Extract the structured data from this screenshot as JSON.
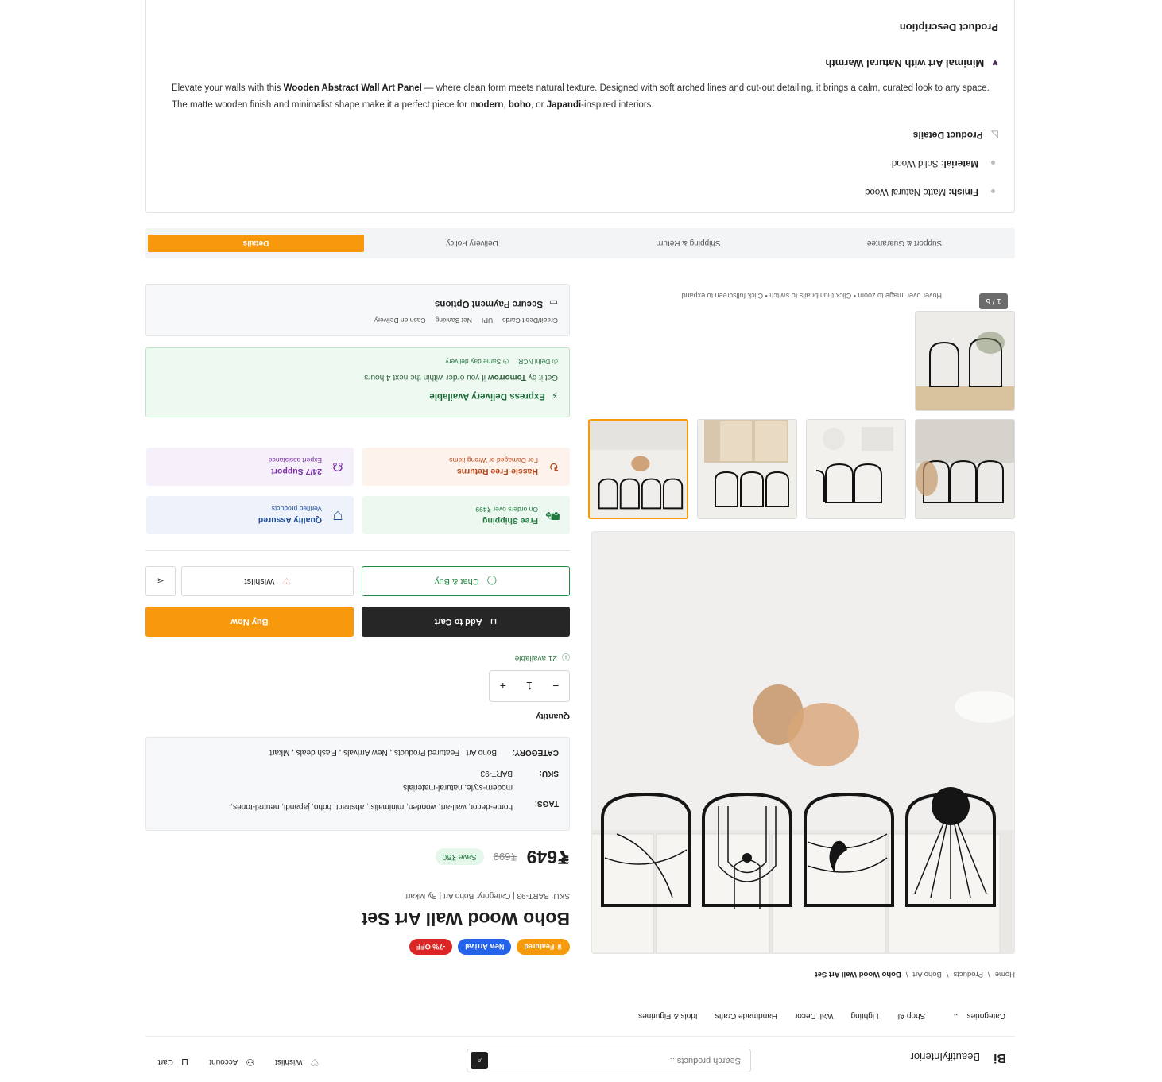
{
  "header": {
    "logo_mark": "Bi",
    "logo_text": "BeautifyInterior",
    "search_placeholder": "Search products...",
    "wishlist": "Wishlist",
    "account": "Account",
    "cart": "Cart"
  },
  "nav": {
    "categories": "Categories",
    "items": [
      "Shop All",
      "Lighting",
      "Wall Decor",
      "Handmade Crafts",
      "Idols & Figurines"
    ]
  },
  "breadcrumb": [
    "Home",
    "Products",
    "Boho Art",
    "Boho Wood Wall Art Set"
  ],
  "gallery": {
    "counter": "1 / 5",
    "hint": "Hover over image to zoom • Click thumbnails to switch • Click fullscreen to expand"
  },
  "product": {
    "badges": [
      "♛ Featured",
      "New Arrival",
      "-7% OFF"
    ],
    "badge_colors": [
      "#f59a0b",
      "#2563eb",
      "#dc2626"
    ],
    "title": "Boho Wood Wall Art Set",
    "meta": "SKU: BART-93 | Category: Boho Art | By Mkart",
    "price": "₹649",
    "mrp": "₹699",
    "save": "Save ₹50"
  },
  "info": {
    "category_label": "CATEGORY:",
    "category_value": "Boho Art , Featured Products , New Arrivals , Flash deals , Mkart",
    "sku_label": "SKU:",
    "sku_value": "BART-93",
    "tags_label": "TAGS:",
    "tags_line1": "home-decor, wall-art, wooden, minimalist, abstract, boho, japandi, neutral-tones,",
    "tags_line2": "modern-style, natural-materials"
  },
  "quantity": {
    "label": "Quantity",
    "value": "1",
    "minus": "−",
    "plus": "+",
    "available": "21 available"
  },
  "actions": {
    "add_to_cart": "Add to Cart",
    "buy_now": "Buy Now",
    "chat_buy": "Chat & Buy",
    "wishlist": "Wishlist"
  },
  "features": {
    "shipping_title": "Free Shipping",
    "shipping_sub": "On orders over ₹499",
    "quality_title": "Quality Assured",
    "quality_sub": "Verified products",
    "returns_title": "Hassle-Free Returns",
    "returns_sub": "For Damaged or Wrong items",
    "support_title": "24/7 Support",
    "support_sub": "Expert assistance"
  },
  "express": {
    "title": "Express Delivery Available",
    "pre": "Get it by ",
    "day": "Tomorrow",
    "post": " if you order within the next 4 hours",
    "tag1": "Delhi NCR",
    "tag2": "Same day delivery"
  },
  "payment": {
    "title": "Secure Payment Options",
    "options": [
      "Credit/Debit Cards",
      "UPI",
      "Net Banking",
      "Cash on Delivery"
    ]
  },
  "tabs": [
    "Details",
    "Delivery Policy",
    "Shipping & Return",
    "Support & Guarantee"
  ],
  "description": {
    "heading": "Product Description",
    "sub_heading": "Minimal Art with Natural Warmth",
    "p1_a": "Elevate your walls with this ",
    "p1_b": "Wooden Abstract Wall Art Panel",
    "p1_c": " — where clean form meets natural texture. Designed with soft arched lines and cut-out detailing, it brings a calm, curated look to any space. The matte wooden finish and minimalist shape make it a perfect piece for ",
    "p1_d": "modern",
    "p1_e": ", ",
    "p1_f": "boho",
    "p1_g": ", or ",
    "p1_h": "Japandi",
    "p1_i": "-inspired interiors.",
    "details_heading": "Product Details",
    "material_label": "Material:",
    "material_value": " Solid Wood",
    "finish_label": "Finish:",
    "finish_value": " Matte Natural Wood"
  }
}
